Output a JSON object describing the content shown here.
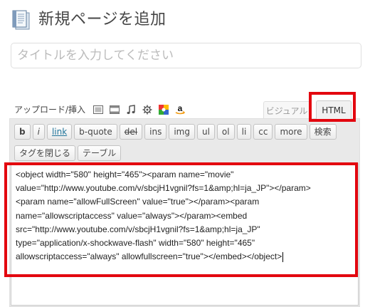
{
  "header": {
    "title": "新規ページを追加"
  },
  "title_field": {
    "placeholder": "タイトルを入力してください"
  },
  "media": {
    "label": "アップロード/挿入",
    "icons": [
      "image-icon",
      "video-icon",
      "audio-icon",
      "media-gear-icon",
      "picasa-icon",
      "amazon-icon"
    ]
  },
  "tabs": {
    "visual": "ビジュアル",
    "html": "HTML"
  },
  "toolbar": {
    "row1": [
      "b",
      "i",
      "link",
      "b-quote",
      "del",
      "ins",
      "img",
      "ul",
      "ol",
      "li",
      "cc",
      "more",
      "検索"
    ],
    "row2": [
      "タグを閉じる",
      "テーブル"
    ]
  },
  "editor": {
    "lines": [
      "<object width=\"580\" height=\"465\"><param name=\"movie\"",
      "value=\"http://www.youtube.com/v/sbcjH1vgnil?fs=1&amp;hl=ja_JP\"></param>",
      "<param name=\"allowFullScreen\" value=\"true\"></param><param",
      "name=\"allowscriptaccess\" value=\"always\"></param><embed",
      "src=\"http://www.youtube.com/v/sbcjH1vgnil?fs=1&amp;hl=ja_JP\"",
      "type=\"application/x-shockwave-flash\" width=\"580\" height=\"465\"",
      "allowscriptaccess=\"always\" allowfullscreen=\"true\"></embed></object>"
    ]
  },
  "colors": {
    "highlight": "#e3070f",
    "link": "#21759b"
  }
}
